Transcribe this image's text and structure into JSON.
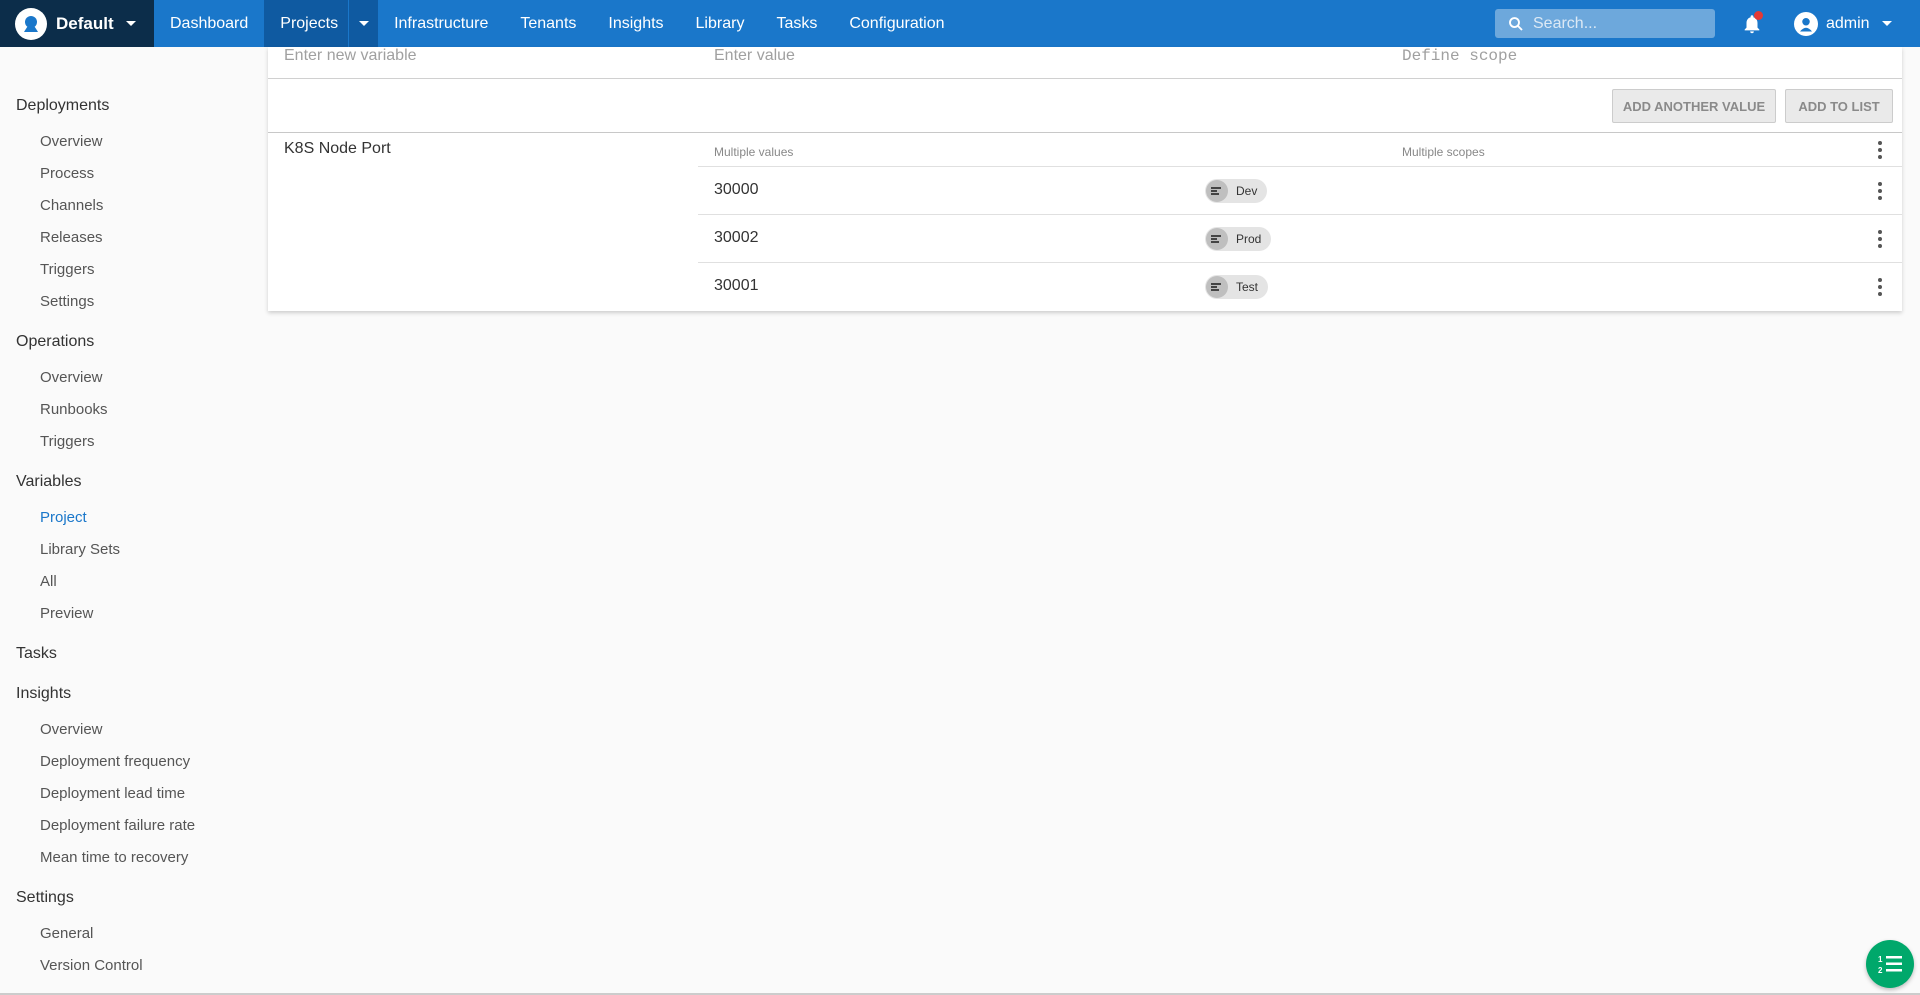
{
  "topnav": {
    "space_name": "Default",
    "items": [
      "Dashboard",
      "Projects",
      "Infrastructure",
      "Tenants",
      "Insights",
      "Library",
      "Tasks",
      "Configuration"
    ],
    "search_placeholder": "Search...",
    "user_name": "admin",
    "colors": {
      "bar": "#1a77ca",
      "space_bg": "#0c2d4a",
      "active": "#0f5aa1"
    }
  },
  "sidebar": {
    "deployments": {
      "title": "Deployments",
      "items": [
        "Overview",
        "Process",
        "Channels",
        "Releases",
        "Triggers",
        "Settings"
      ]
    },
    "operations": {
      "title": "Operations",
      "items": [
        "Overview",
        "Runbooks",
        "Triggers"
      ]
    },
    "variables": {
      "title": "Variables",
      "items": [
        "Project",
        "Library Sets",
        "All",
        "Preview"
      ],
      "active": "Project"
    },
    "tasks": {
      "title": "Tasks"
    },
    "insights": {
      "title": "Insights",
      "items": [
        "Overview",
        "Deployment frequency",
        "Deployment lead time",
        "Deployment failure rate",
        "Mean time to recovery"
      ]
    },
    "settings": {
      "title": "Settings",
      "items": [
        "General",
        "Version Control"
      ]
    }
  },
  "editor": {
    "new_variable_placeholder": "Enter new variable",
    "value_placeholder": "Enter value",
    "scope_placeholder": "Define scope",
    "add_another_value": "ADD ANOTHER VALUE",
    "add_to_list": "ADD TO LIST"
  },
  "variable": {
    "name": "K8S Node Port",
    "values_header": "Multiple values",
    "scopes_header": "Multiple scopes",
    "rows": [
      {
        "value": "30000",
        "scope": "Dev"
      },
      {
        "value": "30002",
        "scope": "Prod"
      },
      {
        "value": "30001",
        "scope": "Test"
      }
    ]
  },
  "icons": [
    "octopus-logo-icon",
    "search-icon",
    "bell-icon",
    "user-avatar-icon",
    "environment-icon",
    "more-vert-icon",
    "list-fab-icon"
  ],
  "accent": "#1a77ca",
  "fab_color": "#00a86b"
}
